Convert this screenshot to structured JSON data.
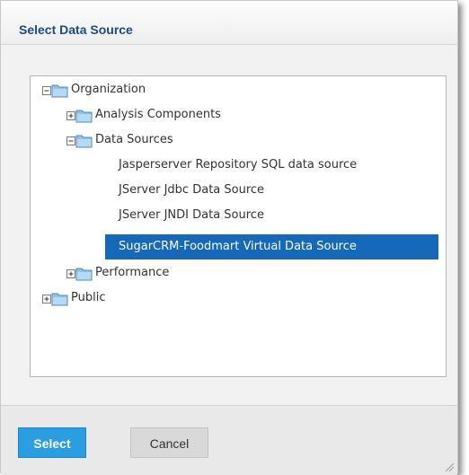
{
  "dialog": {
    "title": "Select Data Source"
  },
  "tree": {
    "root1": {
      "label": "Organization",
      "expander": "minus-icon",
      "icon": "folder-icon"
    },
    "analysis": {
      "label": "Analysis Components",
      "expander": "plus-icon",
      "icon": "folder-icon"
    },
    "datasources": {
      "label": "Data Sources",
      "expander": "minus-icon",
      "icon": "folder-icon"
    },
    "leaves": [
      "Jasperserver Repository SQL data source",
      "JServer Jdbc Data Source",
      "JServer JNDI Data Source",
      "SugarCRM-Foodmart Virtual Data Source"
    ],
    "selected_index": 3,
    "performance": {
      "label": "Performance",
      "expander": "plus-icon",
      "icon": "folder-icon"
    },
    "root2": {
      "label": "Public",
      "expander": "plus-icon",
      "icon": "folder-icon"
    }
  },
  "footer": {
    "select_label": "Select",
    "cancel_label": "Cancel"
  },
  "colors": {
    "accent": "#2b9ee2",
    "selected": "#1569b8",
    "title": "#1b4a8a"
  }
}
